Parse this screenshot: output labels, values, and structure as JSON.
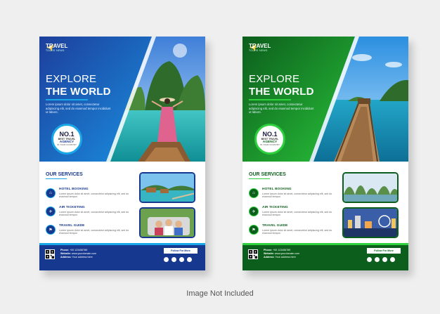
{
  "flyers": [
    {
      "variant": "blue",
      "brand": "TRAVEL",
      "brand_sub": "TOURS NEWS",
      "headline_line1": "EXPLORE",
      "headline_line2": "THE WORLD",
      "intro": "Lorem ipsum dolor sit amet, consectetur adipiscing elit, sed do eiusmod tempor incididunt ut labore.",
      "badge": {
        "rank": "NO.1",
        "line1": "BEST TRAVEL",
        "line2": "AGENCY",
        "line3": "IN YOUR COUNTRY"
      },
      "services_title": "OUR SERVICES",
      "services": [
        {
          "title": "HOTEL BOOKING",
          "desc": "Lorem ipsum dolor sit amet, consectetur adipiscing elit, sed do eiusmod tempor.",
          "icon": "hotel-icon"
        },
        {
          "title": "AIR TICKETING",
          "desc": "Lorem ipsum dolor sit amet, consectetur adipiscing elit, sed do eiusmod tempor.",
          "icon": "plane-icon"
        },
        {
          "title": "TRAVEL GUIDE",
          "desc": "Lorem ipsum dolor sit amet, consectetur adipiscing elit, sed do eiusmod tempor.",
          "icon": "guide-icon"
        }
      ],
      "contact": {
        "phone_label": "Phone:",
        "phone": "+00 123456789",
        "web_label": "Website:",
        "web": "www.yourdomain.com",
        "addr_label": "Address:",
        "addr": "Your address here"
      },
      "follow": "Follow For More",
      "colors": {
        "primary": "#17388f",
        "accent": "#1aa7e8"
      }
    },
    {
      "variant": "green",
      "brand": "TRAVEL",
      "brand_sub": "TOURS NEWS",
      "headline_line1": "EXPLORE",
      "headline_line2": "THE WORLD",
      "intro": "Lorem ipsum dolor sit amet, consectetur adipiscing elit, sed do eiusmod tempor incididunt ut labore.",
      "badge": {
        "rank": "NO.1",
        "line1": "BEST TRAVEL",
        "line2": "AGENCY",
        "line3": "IN YOUR COUNTRY"
      },
      "services_title": "OUR SERVICES",
      "services": [
        {
          "title": "HOTEL BOOKING",
          "desc": "Lorem ipsum dolor sit amet, consectetur adipiscing elit, sed do eiusmod tempor.",
          "icon": "hotel-icon"
        },
        {
          "title": "AIR TICKETING",
          "desc": "Lorem ipsum dolor sit amet, consectetur adipiscing elit, sed do eiusmod tempor.",
          "icon": "plane-icon"
        },
        {
          "title": "TRAVEL GUIDE",
          "desc": "Lorem ipsum dolor sit amet, consectetur adipiscing elit, sed do eiusmod tempor.",
          "icon": "guide-icon"
        }
      ],
      "contact": {
        "phone_label": "Phone:",
        "phone": "+00 123456789",
        "web_label": "Website:",
        "web": "www.yourdomain.com",
        "addr_label": "Address:",
        "addr": "Your address here"
      },
      "follow": "Follow For More",
      "colors": {
        "primary": "#0c5e1c",
        "accent": "#2fcf3e"
      }
    }
  ],
  "caption": "Image Not Included"
}
